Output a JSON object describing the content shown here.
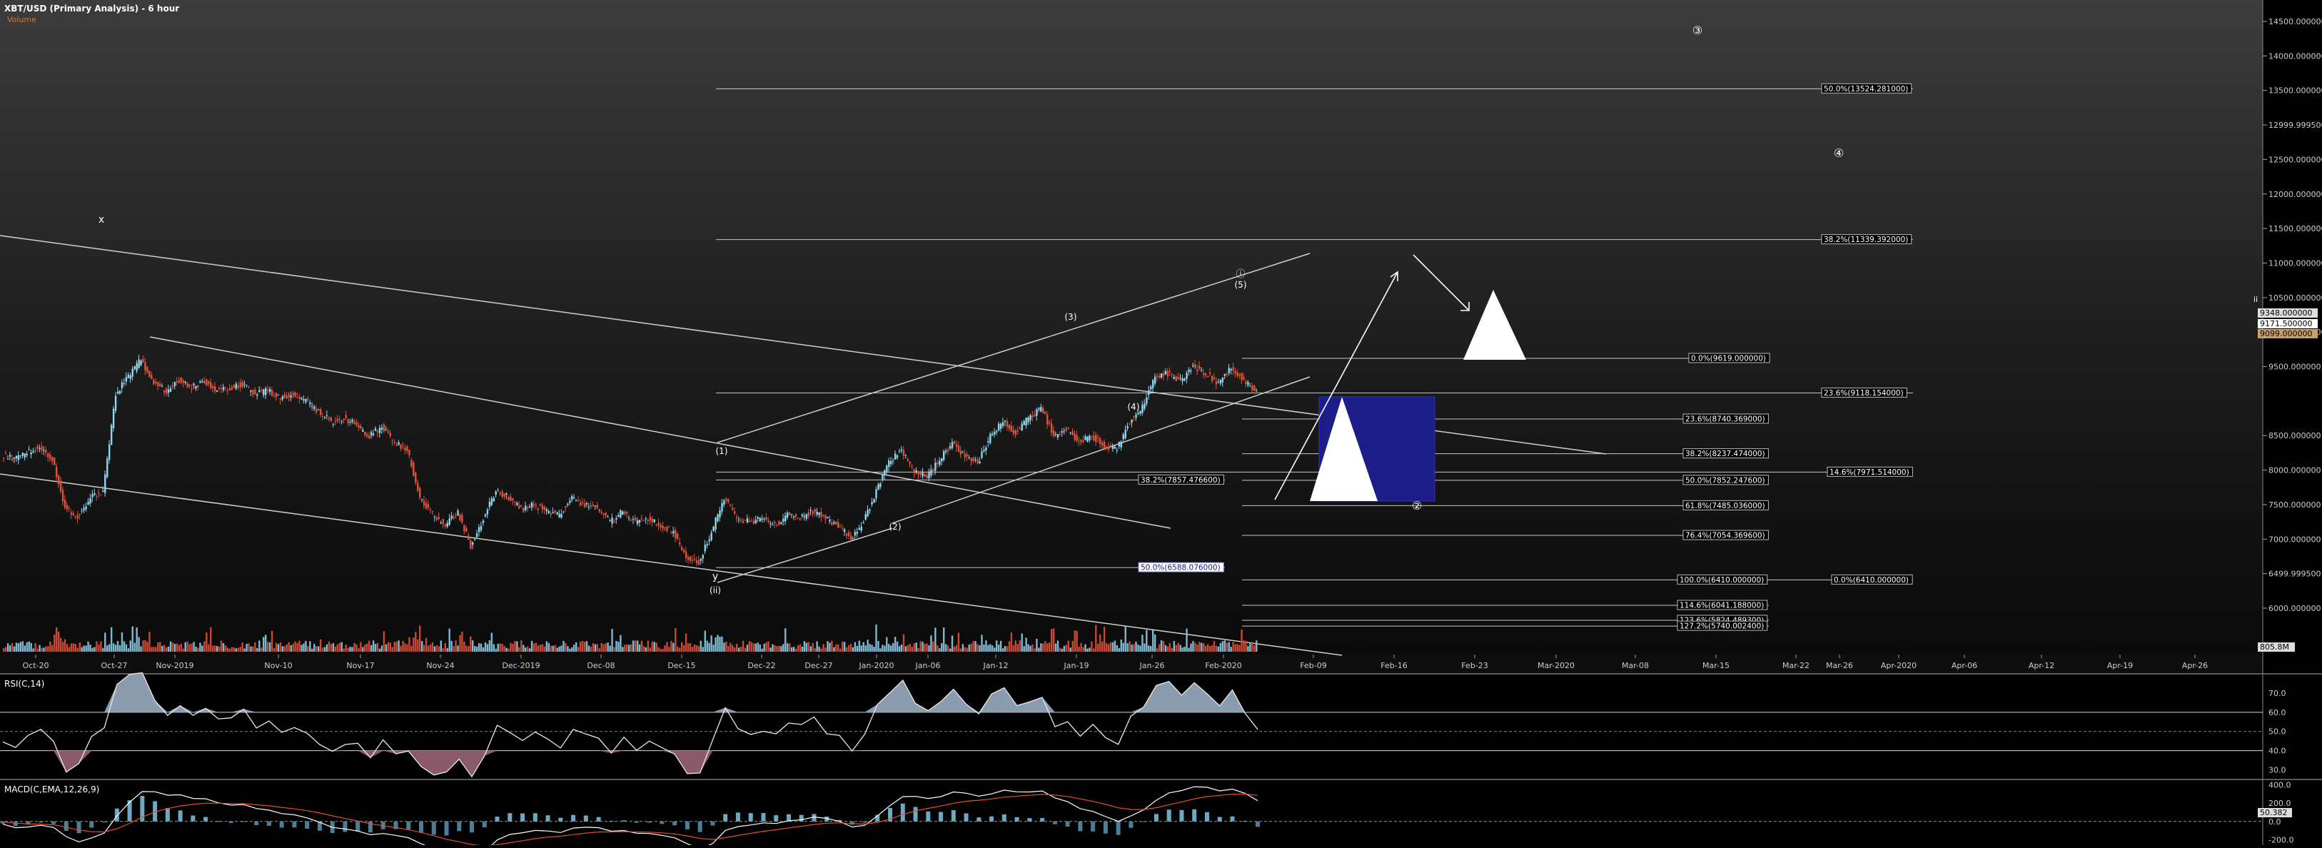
{
  "title": "XBT/USD (Primary Analysis) - 6 hour",
  "volume_label": "Volume",
  "volume_value": "805.8M",
  "wave_labels": [
    "x",
    "y",
    "(ii)",
    "(1)",
    "(2)",
    "(3)",
    "(4)",
    "(5)",
    "ⓘ",
    "③",
    "④",
    "②",
    "ii"
  ],
  "price_labels": [
    "9348.000000",
    "9171.500000",
    "9099.000000"
  ],
  "chart_data": [
    {
      "type": "line",
      "name": "XBT/USD price",
      "x_tick_labels": [
        "Oct-20",
        "Oct-27",
        "Nov-2019",
        "Nov-10",
        "Nov-17",
        "Nov-24",
        "Dec-2019",
        "Dec-08",
        "Dec-15",
        "Dec-22",
        "Dec-27",
        "Jan-2020",
        "Jan-06",
        "Jan-12",
        "Jan-19",
        "Jan-26",
        "Feb-2020",
        "Feb-09",
        "Feb-16",
        "Feb-23",
        "Mar-2020",
        "Mar-08",
        "Mar-15",
        "Mar-22",
        "Mar-26",
        "Apr-2020",
        "Apr-06",
        "Apr-12",
        "Apr-19",
        "Apr-26"
      ],
      "y_tick_labels": [
        "14500.000000",
        "14000.000000",
        "13500.000000",
        "12999.999500",
        "12500.000000",
        "12000.000000",
        "11500.000000",
        "11000.000000",
        "10500.000000",
        "10000.000000",
        "9500.000000",
        "8500.000000",
        "8000.000000",
        "7500.000000",
        "7000.000000",
        "6499.999500",
        "6000.000000"
      ],
      "ylim": [
        5500,
        14700
      ],
      "close_approx": [
        8220,
        8160,
        8260,
        8330,
        8150,
        7450,
        7320,
        7600,
        7700,
        9100,
        9350,
        9600,
        9250,
        9150,
        9300,
        9200,
        9280,
        9150,
        9180,
        9250,
        9100,
        9150,
        9050,
        9100,
        9000,
        8850,
        8700,
        8760,
        8650,
        8500,
        8620,
        8400,
        8300,
        7600,
        7350,
        7200,
        7400,
        6900,
        7300,
        7700,
        7600,
        7450,
        7500,
        7400,
        7350,
        7600,
        7500,
        7450,
        7250,
        7400,
        7250,
        7300,
        7200,
        7100,
        6750,
        6650,
        7100,
        7600,
        7300,
        7250,
        7300,
        7200,
        7350,
        7300,
        7400,
        7300,
        7200,
        7000,
        7250,
        7700,
        8100,
        8300,
        8000,
        7900,
        8150,
        8400,
        8200,
        8100,
        8500,
        8700,
        8550,
        8750,
        8900,
        8500,
        8600,
        8400,
        8500,
        8350,
        8300,
        8700,
        8900,
        9350,
        9400,
        9300,
        9500,
        9400,
        9250,
        9500,
        9300,
        9150
      ],
      "fib_levels": [
        {
          "label": "50.0%(13524.281000)",
          "value": 13524.281
        },
        {
          "label": "38.2%(11339.392000)",
          "value": 11339.392
        },
        {
          "label": "0.0%(9619.000000)",
          "value": 9619.0
        },
        {
          "label": "23.6%(9118.154000)",
          "value": 9118.154
        },
        {
          "label": "23.6%(8740.369000)",
          "value": 8740.369
        },
        {
          "label": "38.2%(8237.474000)",
          "value": 8237.474
        },
        {
          "label": "14.6%(7971.514000)",
          "value": 7971.514
        },
        {
          "label": "38.2%(7857.476600)",
          "value": 7857.4766
        },
        {
          "label": "50.0%(7852.247600)",
          "value": 7852.2476
        },
        {
          "label": "61.8%(7485.036000)",
          "value": 7485.036
        },
        {
          "label": "76.4%(7054.369600)",
          "value": 7054.3696
        },
        {
          "label": "50.0%(6588.076000)",
          "value": 6588.076
        },
        {
          "label": "100.0%(6410.000000)",
          "value": 6410.0
        },
        {
          "label": "0.0%(6410.000000)",
          "value": 6410.0
        },
        {
          "label": "114.6%(6041.188000)",
          "value": 6041.188
        },
        {
          "label": "123.6%(5824.489300)",
          "value": 5824.4893
        },
        {
          "label": "127.2%(5740.002400)",
          "value": 5740.0024
        }
      ]
    },
    {
      "type": "line",
      "name": "RSI(C,14)",
      "title": "RSI(C,14)",
      "y_tick_labels": [
        "70.0",
        "60.0",
        "50.0",
        "40.0",
        "30.0"
      ],
      "ylim": [
        25,
        80
      ],
      "values_approx": [
        45,
        42,
        48,
        50,
        44,
        30,
        32,
        46,
        50,
        75,
        78,
        80,
        66,
        60,
        65,
        58,
        62,
        55,
        56,
        60,
        52,
        54,
        50,
        52,
        48,
        44,
        40,
        44,
        42,
        38,
        45,
        40,
        38,
        30,
        28,
        27,
        36,
        26,
        38,
        55,
        50,
        46,
        48,
        44,
        42,
        52,
        48,
        46,
        40,
        46,
        40,
        43,
        40,
        38,
        30,
        28,
        45,
        62,
        52,
        50,
        52,
        48,
        54,
        52,
        56,
        50,
        46,
        40,
        50,
        65,
        72,
        75,
        64,
        60,
        66,
        72,
        64,
        60,
        68,
        72,
        64,
        66,
        68,
        54,
        56,
        48,
        52,
        46,
        44,
        60,
        64,
        74,
        75,
        70,
        74,
        68,
        62,
        70,
        60,
        52
      ]
    },
    {
      "type": "line",
      "name": "MACD(C,EMA,12,26,9)",
      "title": "MACD(C,EMA,12,26,9)",
      "y_tick_labels": [
        "400.0",
        "200.0",
        "0.0",
        "-200.0"
      ],
      "ylim": [
        -260,
        460
      ],
      "last_value": "50.382"
    }
  ]
}
